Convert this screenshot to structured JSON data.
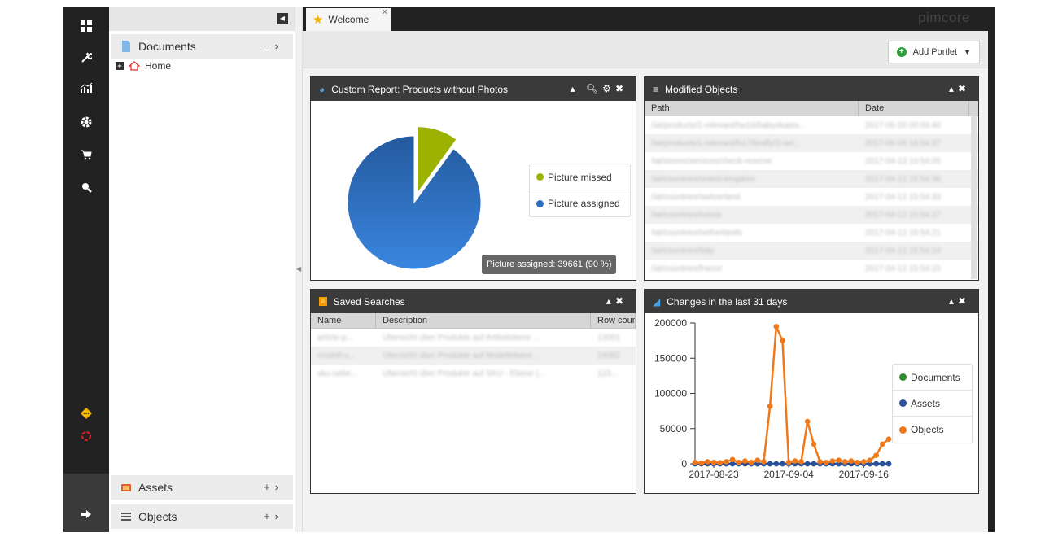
{
  "brand": "pimcore",
  "tab": {
    "label": "Welcome"
  },
  "toolbar": {
    "add_portlet": "Add Portlet"
  },
  "tree": {
    "documents_label": "Documents",
    "home_label": "Home",
    "assets_label": "Assets",
    "objects_label": "Objects"
  },
  "portlets": {
    "custom_report": {
      "title": "Custom Report: Products without Photos",
      "legend": [
        "Picture missed",
        "Picture assigned"
      ],
      "tooltip": "Picture assigned: 39661 (90 %)"
    },
    "modified_objects": {
      "title": "Modified Objects",
      "columns": [
        "Path",
        "Date"
      ],
      "rows": [
        [
          "/iat/products/1-relevant/hw16/babyskates...",
          "2017-06-20 00:04:40"
        ],
        [
          "/iat/products/1-relevant/fs17/brafly/3-set...",
          "2017-05-09 18:54:37"
        ],
        [
          "/iat/stores/services/check-reserve",
          "2017-04-13 10:54:05"
        ],
        [
          "/iat/countries/united-kingdom",
          "2017-04-12 15:54:36"
        ],
        [
          "/iat/countries/switzerland",
          "2017-04-12 15:54:33"
        ],
        [
          "/iat/countries/russia",
          "2017-04-12 15:54:27"
        ],
        [
          "/iat/countries/netherlands",
          "2017-04-12 15:54:21"
        ],
        [
          "/iat/countries/italy",
          "2017-04-12 15:54:19"
        ],
        [
          "/iat/countries/france",
          "2017-04-12 15:54:15"
        ]
      ]
    },
    "saved_searches": {
      "title": "Saved Searches",
      "columns": [
        "Name",
        "Description",
        "Row cour"
      ],
      "rows": [
        [
          "article-p...",
          "Übersicht über Produkte auf Artikelebene ...",
          "13001"
        ],
        [
          "modell-u...",
          "Übersicht über Produkte auf Modellebene ...",
          "24082"
        ],
        [
          "sku-uebe...",
          "Übersicht über Produkte auf SKU - Ebene (...",
          "123..."
        ]
      ]
    },
    "changes": {
      "title": "Changes in the last 31 days",
      "legend": [
        "Documents",
        "Assets",
        "Objects"
      ]
    }
  },
  "colors": {
    "picture_missed": "#9bb300",
    "picture_assigned": "#2f6fbf",
    "documents": "#2e8b2e",
    "assets": "#2a4f9c",
    "objects": "#f07818"
  },
  "chart_data": [
    {
      "type": "pie",
      "title": "Custom Report: Products without Photos",
      "labels": [
        "Picture missed",
        "Picture assigned"
      ],
      "values": [
        4407,
        39661
      ],
      "percent": [
        10,
        90
      ]
    },
    {
      "type": "line",
      "title": "Changes in the last 31 days",
      "x_ticks": [
        "2017-08-23",
        "2017-09-04",
        "2017-09-16"
      ],
      "ylim": [
        0,
        200000
      ],
      "y_ticks": [
        0,
        50000,
        100000,
        150000,
        200000
      ],
      "x": [
        "2017-08-20",
        "2017-08-21",
        "2017-08-22",
        "2017-08-23",
        "2017-08-24",
        "2017-08-25",
        "2017-08-26",
        "2017-08-27",
        "2017-08-28",
        "2017-08-29",
        "2017-08-30",
        "2017-08-31",
        "2017-09-01",
        "2017-09-02",
        "2017-09-03",
        "2017-09-04",
        "2017-09-05",
        "2017-09-06",
        "2017-09-07",
        "2017-09-08",
        "2017-09-09",
        "2017-09-10",
        "2017-09-11",
        "2017-09-12",
        "2017-09-13",
        "2017-09-14",
        "2017-09-15",
        "2017-09-16",
        "2017-09-17",
        "2017-09-18",
        "2017-09-19",
        "2017-09-20"
      ],
      "series": [
        {
          "name": "Documents",
          "values": [
            0,
            0,
            0,
            0,
            0,
            0,
            0,
            0,
            0,
            0,
            0,
            0,
            0,
            0,
            0,
            0,
            0,
            0,
            0,
            0,
            0,
            0,
            0,
            0,
            0,
            0,
            0,
            0,
            0,
            0,
            0,
            0
          ]
        },
        {
          "name": "Assets",
          "values": [
            0,
            0,
            0,
            0,
            0,
            0,
            0,
            0,
            0,
            0,
            0,
            0,
            0,
            0,
            0,
            0,
            0,
            0,
            0,
            0,
            0,
            0,
            0,
            0,
            0,
            0,
            0,
            0,
            0,
            0,
            0,
            0
          ]
        },
        {
          "name": "Objects",
          "values": [
            2000,
            1000,
            3000,
            2000,
            1500,
            3000,
            6000,
            2000,
            4000,
            2000,
            5000,
            3000,
            82000,
            195000,
            175000,
            2000,
            4000,
            3000,
            60000,
            28000,
            3000,
            2000,
            4000,
            5000,
            3000,
            4000,
            2000,
            3000,
            5000,
            12000,
            28000,
            35000
          ]
        }
      ]
    }
  ]
}
